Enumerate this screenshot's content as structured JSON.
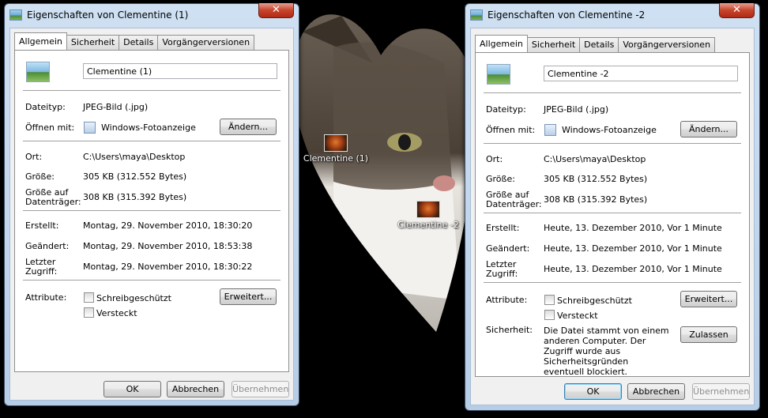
{
  "desktop": {
    "icons": [
      {
        "label": "Clementine (1)"
      },
      {
        "label": "Clementine -2"
      }
    ]
  },
  "dialogs": [
    {
      "title": "Eigenschaften von Clementine (1)",
      "close_glyph": "✕",
      "tabs": [
        "Allgemein",
        "Sicherheit",
        "Details",
        "Vorgängerversionen"
      ],
      "filename": "Clementine (1)",
      "filetype_label": "Dateityp:",
      "filetype_value": "JPEG-Bild (.jpg)",
      "openwith_label": "Öffnen mit:",
      "openwith_value": "Windows-Fotoanzeige",
      "change_button": "Ändern...",
      "location_label": "Ort:",
      "location_value": "C:\\Users\\maya\\Desktop",
      "size_label": "Größe:",
      "size_value": "305 KB (312.552 Bytes)",
      "sizeondisk_label": "Größe auf Datenträger:",
      "sizeondisk_value": "308 KB (315.392 Bytes)",
      "created_label": "Erstellt:",
      "created_value": "Montag, 29. November 2010, 18:30:20",
      "modified_label": "Geändert:",
      "modified_value": "Montag, 29. November 2010, 18:53:38",
      "accessed_label": "Letzter Zugriff:",
      "accessed_value": "Montag, 29. November 2010, 18:30:22",
      "attributes_label": "Attribute:",
      "readonly_label": "Schreibgeschützt",
      "hidden_label": "Versteckt",
      "advanced_button": "Erweitert...",
      "ok_button": "OK",
      "cancel_button": "Abbrechen",
      "apply_button": "Übernehmen"
    },
    {
      "title": "Eigenschaften von Clementine -2",
      "close_glyph": "✕",
      "tabs": [
        "Allgemein",
        "Sicherheit",
        "Details",
        "Vorgängerversionen"
      ],
      "filename": "Clementine -2",
      "filetype_label": "Dateityp:",
      "filetype_value": "JPEG-Bild (.jpg)",
      "openwith_label": "Öffnen mit:",
      "openwith_value": "Windows-Fotoanzeige",
      "change_button": "Ändern...",
      "location_label": "Ort:",
      "location_value": "C:\\Users\\maya\\Desktop",
      "size_label": "Größe:",
      "size_value": "305 KB (312.552 Bytes)",
      "sizeondisk_label": "Größe auf Datenträger:",
      "sizeondisk_value": "308 KB (315.392 Bytes)",
      "created_label": "Erstellt:",
      "created_value": "Heute, 13. Dezember 2010, Vor 1 Minute",
      "modified_label": "Geändert:",
      "modified_value": "Heute, 13. Dezember 2010, Vor 1 Minute",
      "accessed_label": "Letzter Zugriff:",
      "accessed_value": "Heute, 13. Dezember 2010, Vor 1 Minute",
      "attributes_label": "Attribute:",
      "readonly_label": "Schreibgeschützt",
      "hidden_label": "Versteckt",
      "advanced_button": "Erweitert...",
      "security_label": "Sicherheit:",
      "security_text": "Die Datei stammt von einem anderen Computer. Der Zugriff wurde aus Sicherheitsgründen eventuell blockiert.",
      "unblock_button": "Zulassen",
      "ok_button": "OK",
      "cancel_button": "Abbrechen",
      "apply_button": "Übernehmen"
    }
  ]
}
